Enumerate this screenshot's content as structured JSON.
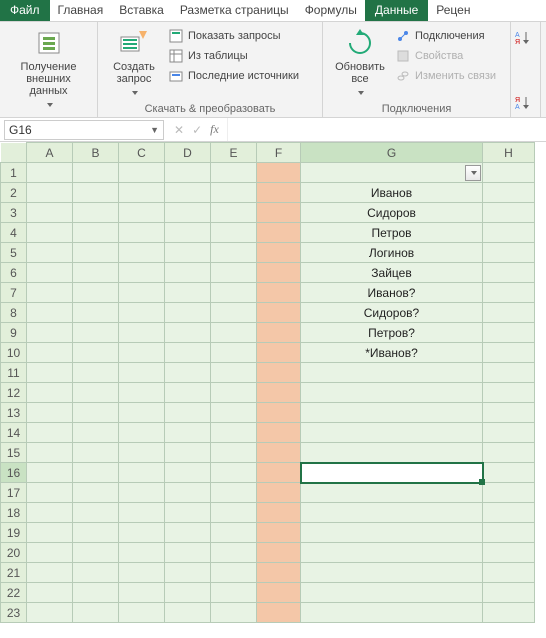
{
  "tabs": {
    "file": "Файл",
    "items": [
      "Главная",
      "Вставка",
      "Разметка страницы",
      "Формулы",
      "Данные",
      "Рецен"
    ],
    "active_index": 4
  },
  "ribbon": {
    "group1": {
      "get_data": "Получение\nвнешних данных",
      "label": ""
    },
    "group2": {
      "new_query": "Создать\nзапрос",
      "show_queries": "Показать запросы",
      "from_table": "Из таблицы",
      "recent_sources": "Последние источники",
      "label": "Скачать & преобразовать"
    },
    "group3": {
      "refresh_all": "Обновить\nвсе",
      "connections": "Подключения",
      "properties": "Свойства",
      "edit_links": "Изменить связи",
      "label": "Подключения"
    }
  },
  "name_box": "G16",
  "fx": "fx",
  "columns": [
    "A",
    "B",
    "C",
    "D",
    "E",
    "F",
    "G",
    "H"
  ],
  "rows_count": 23,
  "active": {
    "col": "G",
    "row": 16
  },
  "filter_col": "G",
  "data_G": {
    "2": "Иванов",
    "3": "Сидоров",
    "4": "Петров",
    "5": "Логинов",
    "6": "Зайцев",
    "7": "Иванов?",
    "8": "Сидоров?",
    "9": "Петров?",
    "10": "*Иванов?"
  },
  "colors": {
    "accent": "#217346",
    "cell": "#e8f3e4",
    "header": "#e2efda",
    "colF": "#f4c7a8"
  }
}
